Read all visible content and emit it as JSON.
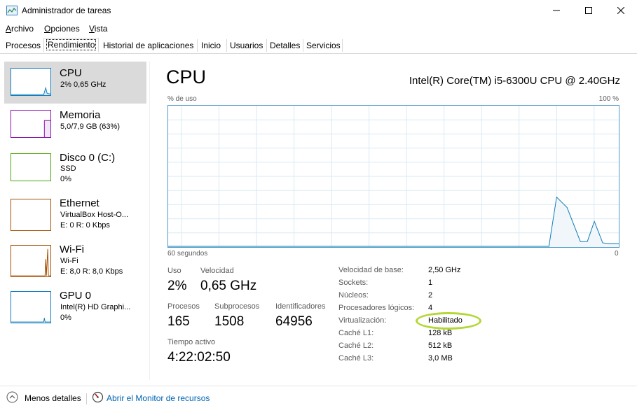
{
  "window": {
    "title": "Administrador de tareas",
    "minimize": "—",
    "maximize": "☐",
    "close": "✕"
  },
  "menu": {
    "items": [
      "Archivo",
      "Opciones",
      "Vista"
    ]
  },
  "tabs": [
    "Procesos",
    "Rendimiento",
    "Historial de aplicaciones",
    "Inicio",
    "Usuarios",
    "Detalles",
    "Servicios"
  ],
  "active_tab": "Rendimiento",
  "sidebar": {
    "items": [
      {
        "title": "CPU",
        "line1": "2%  0,65 GHz",
        "line2": "",
        "color": "#117dbb",
        "selected": true
      },
      {
        "title": "Memoria",
        "line1": "5,0/7,9 GB (63%)",
        "line2": "",
        "color": "#8b12ae",
        "selected": false
      },
      {
        "title": "Disco 0 (C:)",
        "line1": "SSD",
        "line2": "0%",
        "color": "#4da60c",
        "selected": false
      },
      {
        "title": "Ethernet",
        "line1": "VirtualBox Host-O...",
        "line2": "E: 0  R: 0 Kbps",
        "color": "#a74f01",
        "selected": false
      },
      {
        "title": "Wi-Fi",
        "line1": "Wi-Fi",
        "line2": "E: 8,0  R: 8,0 Kbps",
        "color": "#a74f01",
        "selected": false
      },
      {
        "title": "GPU 0",
        "line1": "Intel(R) HD Graphi...",
        "line2": "0%",
        "color": "#117dbb",
        "selected": false
      }
    ]
  },
  "main": {
    "title": "CPU",
    "model": "Intel(R) Core(TM) i5-6300U CPU @ 2.40GHz",
    "graph": {
      "top_left": "% de uso",
      "top_right": "100 %",
      "bottom_left": "60 segundos",
      "bottom_right": "0"
    },
    "stats": {
      "uso_label": "Uso",
      "uso_value": "2%",
      "velocidad_label": "Velocidad",
      "velocidad_value": "0,65 GHz",
      "procesos_label": "Procesos",
      "procesos_value": "165",
      "subprocesos_label": "Subprocesos",
      "subprocesos_value": "1508",
      "identificadores_label": "Identificadores",
      "identificadores_value": "64956",
      "tiempo_label": "Tiempo activo",
      "tiempo_value": "4:22:02:50"
    },
    "specs": [
      {
        "label": "Velocidad de base:",
        "value": "2,50 GHz"
      },
      {
        "label": "Sockets:",
        "value": "1"
      },
      {
        "label": "Núcleos:",
        "value": "2"
      },
      {
        "label": "Procesadores lógicos:",
        "value": "4"
      },
      {
        "label": "Virtualización:",
        "value": "Habilitado"
      },
      {
        "label": "Caché L1:",
        "value": "128 kB"
      },
      {
        "label": "Caché L2:",
        "value": "512 kB"
      },
      {
        "label": "Caché L3:",
        "value": "3,0 MB"
      }
    ]
  },
  "footer": {
    "less_details": "Menos detalles",
    "resource_monitor": "Abrir el Monitor de recursos"
  },
  "colors": {
    "cpu": "#117dbb",
    "graph_fill": "#f1f6fa",
    "highlight": "#b3d735"
  }
}
